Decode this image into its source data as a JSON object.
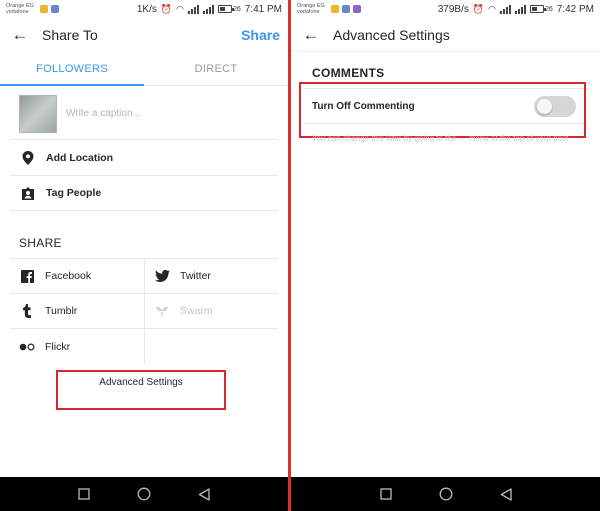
{
  "left": {
    "status": {
      "carrier_line1": "Orange EG",
      "carrier_line2": "vodafone",
      "speed": "1K/s",
      "battery": "26",
      "time": "7:41 PM"
    },
    "header": {
      "title": "Share To",
      "action": "Share"
    },
    "tabs": [
      {
        "label": "FOLLOWERS",
        "active": true
      },
      {
        "label": "DIRECT",
        "active": false
      }
    ],
    "caption": {
      "placeholder": "Write a caption..."
    },
    "options": [
      {
        "label": "Add Location",
        "icon": "location-pin-icon"
      },
      {
        "label": "Tag People",
        "icon": "tag-person-icon"
      }
    ],
    "share_heading": "SHARE",
    "share_targets": [
      {
        "label": "Facebook",
        "icon": "facebook-icon",
        "enabled": true
      },
      {
        "label": "Twitter",
        "icon": "twitter-icon",
        "enabled": true
      },
      {
        "label": "Tumblr",
        "icon": "tumblr-icon",
        "enabled": true
      },
      {
        "label": "Swarm",
        "icon": "swarm-icon",
        "enabled": false
      },
      {
        "label": "Flickr",
        "icon": "flickr-icon",
        "enabled": true
      }
    ],
    "advanced_link": "Advanced Settings"
  },
  "right": {
    "status": {
      "carrier_line1": "Orange EG",
      "carrier_line2": "vodafone",
      "speed": "379B/s",
      "battery": "26",
      "time": "7:42 PM"
    },
    "header": {
      "title": "Advanced Settings"
    },
    "comments_heading": "COMMENTS",
    "toggle_label": "Turn Off Commenting",
    "toggle_on": false,
    "hint": "You can change this later by going to the ··· menu at the top of your post."
  },
  "colors": {
    "accent": "#3897f0",
    "highlight_box": "#d9282f",
    "divider": "#e02c2c",
    "navbar": "#000000"
  }
}
